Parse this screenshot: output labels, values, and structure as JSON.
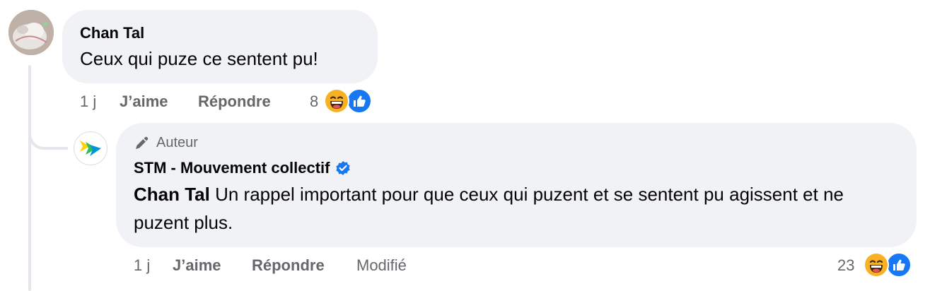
{
  "comment": {
    "author": "Chan Tal",
    "text": "Ceux qui puze ce sentent pu!",
    "time": "1 j",
    "like_label": "J’aime",
    "reply_label": "Répondre",
    "reaction_count": "8",
    "reactions": [
      "laughing-emoji",
      "like-thumb-icon"
    ]
  },
  "reply": {
    "badge": "Auteur",
    "author": "STM - Mouvement collectif",
    "verified": true,
    "mention": "Chan Tal",
    "text": " Un rappel important pour que ceux qui puzent et se sentent pu agissent et ne puzent plus.",
    "time": "1 j",
    "like_label": "J’aime",
    "reply_label": "Répondre",
    "edited_label": "Modifié",
    "reaction_count": "23",
    "reactions": [
      "laughing-emoji",
      "like-thumb-icon"
    ]
  },
  "colors": {
    "bubble": "#f0f2f5",
    "meta_text": "#65676b",
    "like_blue": "#1877f2",
    "verified_blue": "#1877f2",
    "stm_yellow": "#ffd200",
    "stm_green": "#2dbd5a",
    "stm_blue": "#0096d6"
  }
}
